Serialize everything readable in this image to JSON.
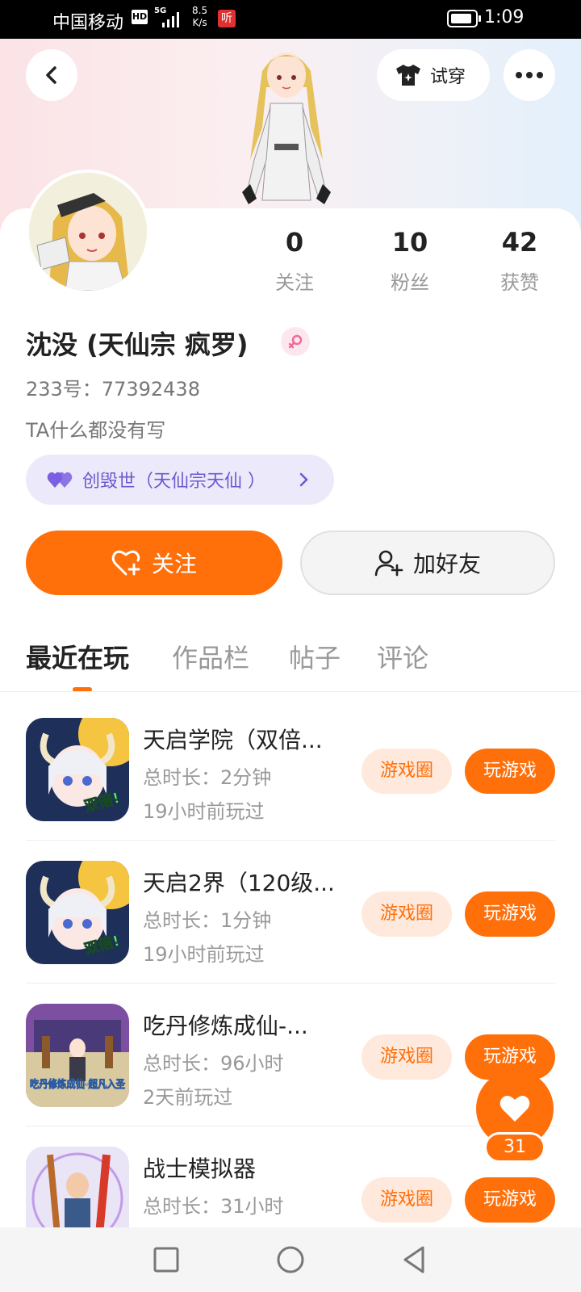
{
  "status_bar": {
    "carrier": "中国移动",
    "hd": "HD",
    "net_type": "5G",
    "speed_value": "8.5",
    "speed_unit": "K/s",
    "app_badge": "听",
    "battery_level": 0.9,
    "time": "1:09"
  },
  "header": {
    "try_on_label": "试穿"
  },
  "profile": {
    "stats": [
      {
        "value": "0",
        "label": "关注"
      },
      {
        "value": "10",
        "label": "粉丝"
      },
      {
        "value": "42",
        "label": "获赞"
      }
    ],
    "nickname": "沈没 (天仙宗 疯罗)",
    "user_id": "233号：77392438",
    "bio": "TA什么都没有写",
    "guild": "创毁世（天仙宗天仙 ）"
  },
  "actions": {
    "follow_label": "关注",
    "add_friend_label": "加好友"
  },
  "tabs": [
    "最近在玩",
    "作品栏",
    "帖子",
    "评论"
  ],
  "games": [
    {
      "name": "天启学院（双倍...",
      "duration": "总时长：2分钟",
      "last_played": "19小时前玩过",
      "icon_text": "双倍!",
      "circle_label": "游戏圈",
      "play_label": "玩游戏"
    },
    {
      "name": "天启2界（120级...",
      "duration": "总时长：1分钟",
      "last_played": "19小时前玩过",
      "icon_text": "双倍!",
      "circle_label": "游戏圈",
      "play_label": "玩游戏"
    },
    {
      "name": "吃丹修炼成仙-...",
      "duration": "总时长：96小时",
      "last_played": "2天前玩过",
      "icon_text": "吃丹修炼成仙-超凡入圣",
      "circle_label": "游戏圈",
      "play_label": "玩游戏"
    },
    {
      "name": "战士模拟器",
      "duration": "总时长：31小时",
      "last_played": "",
      "icon_text": "",
      "circle_label": "游戏圈",
      "play_label": "玩游戏"
    }
  ],
  "like_fab": {
    "count": "31"
  },
  "colors": {
    "accent": "#ff6f0a",
    "accent_light": "#ffe9dc",
    "guild_bg": "#ece9fb",
    "guild_text": "#6a5acd"
  }
}
